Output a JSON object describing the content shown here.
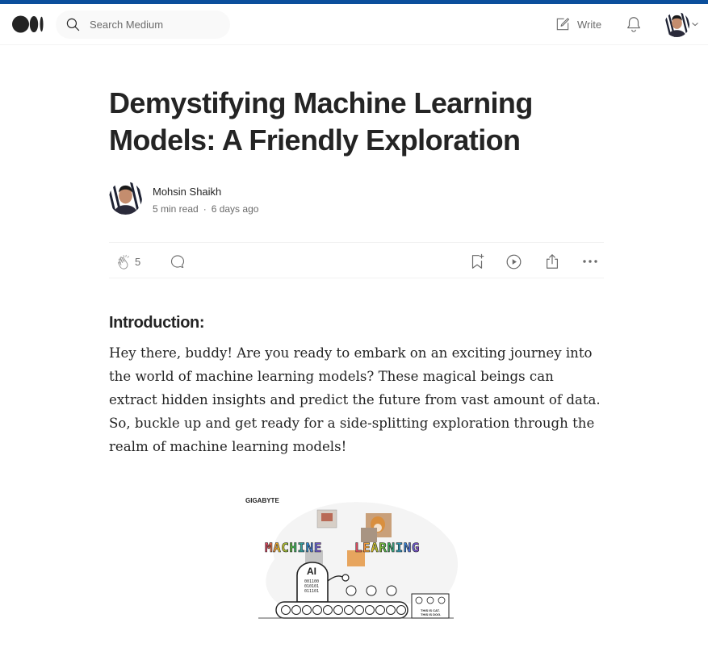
{
  "header": {
    "logo": "medium-logo",
    "search": {
      "placeholder": "Search Medium",
      "value": ""
    },
    "write_label": "Write",
    "icons": {
      "write": "edit-icon",
      "notifications": "bell-icon",
      "account_menu": "chevron-down-icon"
    }
  },
  "article": {
    "title": "Demystifying Machine Learning Models: A Friendly Exploration",
    "author": {
      "name": "Mohsin Shaikh",
      "read_time": "5 min read",
      "separator": "·",
      "published": "6 days ago"
    },
    "actions": {
      "clap_count": "5",
      "icons": [
        "clap-icon",
        "comment-icon",
        "bookmark-icon",
        "play-icon",
        "share-icon",
        "more-icon"
      ]
    },
    "section_heading": "Introduction:",
    "paragraph": "Hey there, buddy! Are you ready to embark on an exciting journey into the world of machine learning models? These magical beings can extract hidden insights and predict the future from vast amount of data. So, buckle up and get ready for a side-splitting exploration through the realm of machine learning models!",
    "figure": {
      "brand": "GIGABYTE",
      "headline_left": "MACHINE",
      "headline_right": "LEARNING",
      "robot_label": "AI",
      "binary": [
        "001100",
        "010101",
        "011101"
      ],
      "caption_lines": [
        "THIS IS CAT.",
        "THIS IS DOG."
      ]
    }
  },
  "colors": {
    "accent_bar": "#0b4f9c",
    "text_primary": "#242424",
    "text_secondary": "#6b6b6b",
    "search_bg": "#f9f9f9",
    "divider": "#f2f2f2"
  }
}
